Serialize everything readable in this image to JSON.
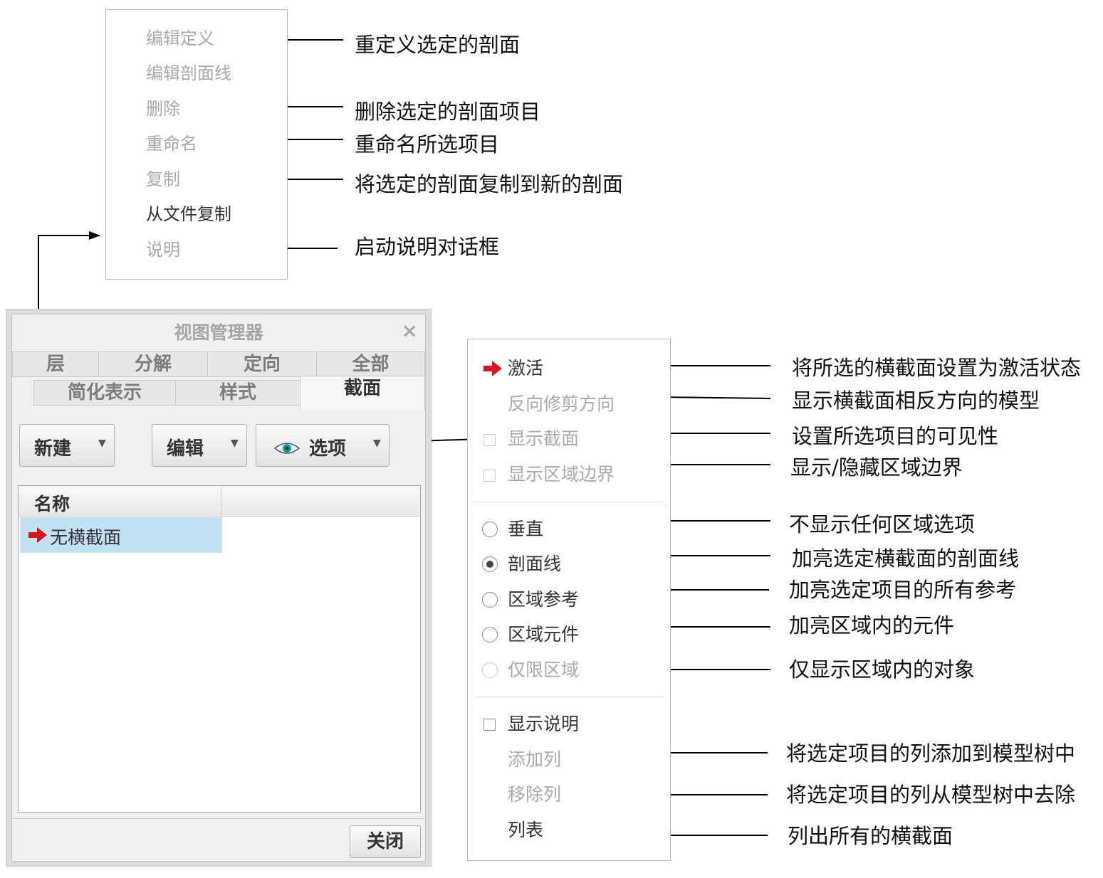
{
  "edit_menu": {
    "items": [
      {
        "label": "编辑定义",
        "enabled": false
      },
      {
        "label": "编辑剖面线",
        "enabled": false
      },
      {
        "label": "删除",
        "enabled": false
      },
      {
        "label": "重命名",
        "enabled": false
      },
      {
        "label": "复制",
        "enabled": false
      },
      {
        "label": "从文件复制",
        "enabled": true
      },
      {
        "label": "说明",
        "enabled": false
      }
    ]
  },
  "view_manager": {
    "title": "视图管理器",
    "close_glyph": "×",
    "tabs_row1": [
      "层",
      "分解",
      "定向",
      "全部"
    ],
    "tabs_row2": [
      "简化表示",
      "样式",
      "截面"
    ],
    "active_tab": "截面",
    "toolbar": {
      "new_label": "新建",
      "edit_label": "编辑",
      "options_label": "选项"
    },
    "list": {
      "column_header": "名称",
      "rows": [
        {
          "name": "无横截面",
          "active": true
        }
      ]
    },
    "close_button": "关闭"
  },
  "options_menu": {
    "activate": "激活",
    "reverse_clip": "反向修剪方向",
    "show_section": "显示截面",
    "show_zone_boundary": "显示区域边界",
    "vertical": "垂直",
    "hatching": "剖面线",
    "zone_reference": "区域参考",
    "zone_components": "区域元件",
    "zone_only": "仅限区域",
    "show_description": "显示说明",
    "add_column": "添加列",
    "remove_column": "移除列",
    "list": "列表"
  },
  "annotations": {
    "redefine": "重定义选定的剖面",
    "delete": "删除选定的剖面项目",
    "rename": "重命名所选项目",
    "copy": "将选定的剖面复制到新的剖面",
    "help": "启动说明对话框",
    "activate": "将所选的横截面设置为激活状态",
    "reverse": "显示横截面相反方向的模型",
    "visibility": "设置所选项目的可见性",
    "boundary": "显示/隐藏区域边界",
    "vertical": "不显示任何区域选项",
    "hatching": "加亮选定横截面的剖面线",
    "zone_ref": "加亮选定项目的所有参考",
    "zone_comp": "加亮区域内的元件",
    "zone_only": "仅显示区域内的对象",
    "add_col": "将选定项目的列添加到模型树中",
    "remove_col": "将选定项目的列从模型树中去除",
    "list_all": "列出所有的横截面"
  },
  "colors": {
    "disabled_text": "#a9a9a9",
    "active_arrow": "#d8141c",
    "selection": "#c2e1f2"
  }
}
